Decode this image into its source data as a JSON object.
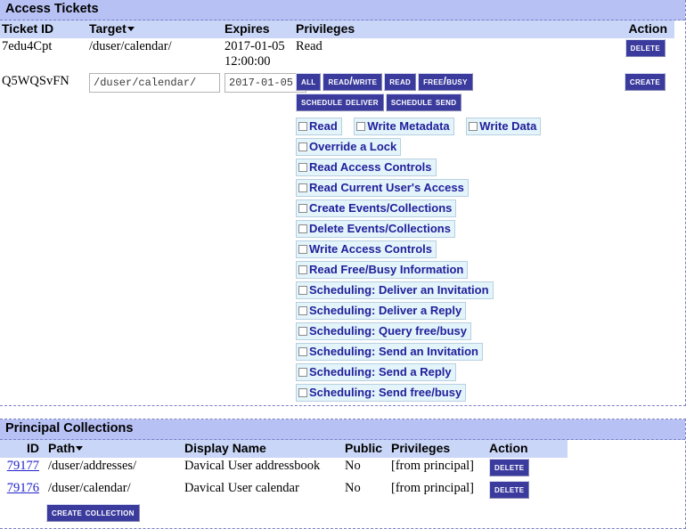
{
  "access_tickets": {
    "title": "Access Tickets",
    "columns": [
      "Ticket ID",
      "Target",
      "Expires",
      "Privileges",
      "Action"
    ],
    "sorted_column": "Target",
    "rows": [
      {
        "ticket_id": "7edu4Cpt",
        "target": "/duser/calendar/",
        "expires": "2017-01-05 12:00:00",
        "privileges": "Read",
        "action_label": "Delete"
      },
      {
        "ticket_id": "Q5WQSvFN",
        "target_value": "/duser/calendar/",
        "expires_value": "2017-01-05",
        "action_label": "Create"
      }
    ],
    "privilege_presets": [
      "All",
      "Read/Write",
      "Read",
      "Free/Busy",
      "Schedule Deliver",
      "Schedule Send"
    ],
    "privilege_checkboxes": [
      {
        "label": "Read",
        "checked": false
      },
      {
        "label": "Write Metadata",
        "checked": false
      },
      {
        "label": "Write Data",
        "checked": false
      },
      {
        "label": "Override a Lock",
        "checked": false
      },
      {
        "label": "Read Access Controls",
        "checked": false
      },
      {
        "label": "Read Current User's Access",
        "checked": false
      },
      {
        "label": "Create Events/Collections",
        "checked": false
      },
      {
        "label": "Delete Events/Collections",
        "checked": false
      },
      {
        "label": "Write Access Controls",
        "checked": false
      },
      {
        "label": "Read Free/Busy Information",
        "checked": false
      },
      {
        "label": "Scheduling: Deliver an Invitation",
        "checked": false
      },
      {
        "label": "Scheduling: Deliver a Reply",
        "checked": false
      },
      {
        "label": "Scheduling: Query free/busy",
        "checked": false
      },
      {
        "label": "Scheduling: Send an Invitation",
        "checked": false
      },
      {
        "label": "Scheduling: Send a Reply",
        "checked": false
      },
      {
        "label": "Scheduling: Send free/busy",
        "checked": false
      }
    ]
  },
  "principal_collections": {
    "title": "Principal Collections",
    "columns": [
      "ID",
      "Path",
      "Display Name",
      "Public",
      "Privileges",
      "Action"
    ],
    "sorted_column": "Path",
    "rows": [
      {
        "id": "79177",
        "path": "/duser/addresses/",
        "display_name": "Davical User addressbook",
        "public": "No",
        "privileges": "[from principal]",
        "action_label": "Delete"
      },
      {
        "id": "79176",
        "path": "/duser/calendar/",
        "display_name": "Davical User calendar",
        "public": "No",
        "privileges": "[from principal]",
        "action_label": "Delete"
      }
    ],
    "create_button_label": "Create Collection"
  },
  "colors": {
    "section_header_bg": "#b7c1f4",
    "column_header_bg": "#c9d6f7",
    "button_bg": "#3b3b9e",
    "chip_bg": "#e3f4fb",
    "chip_text": "#20209a",
    "link": "#2222cc",
    "dashed_border": "#7b7fc4"
  }
}
